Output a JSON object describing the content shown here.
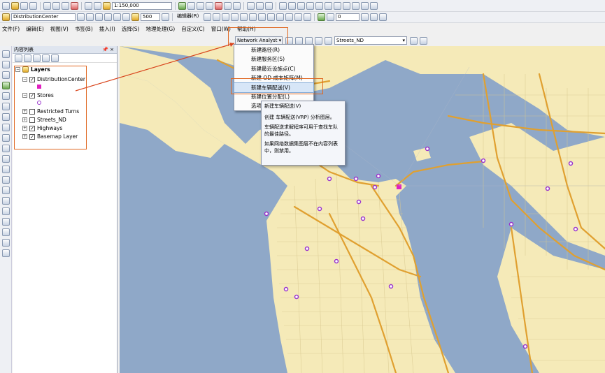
{
  "toolbar1": {
    "scale": "1:150,000"
  },
  "toolbar2": {
    "map_doc": "DistributionCenter",
    "zoom_value": "500",
    "editor_label": "编辑器(R)",
    "angle_value": "0"
  },
  "menu": [
    "文件(F)",
    "编辑(E)",
    "视图(V)",
    "书签(B)",
    "插入(I)",
    "选择(S)",
    "地理处理(G)",
    "自定义(C)",
    "窗口(W)",
    "帮助(H)"
  ],
  "na_toolbar": {
    "button_label": "Network Analyst",
    "network_dataset": "Streets_ND"
  },
  "toc": {
    "title": "内容列表",
    "pin": "📌 ×",
    "root": "Layers",
    "layers": [
      {
        "name": "DistributionCenter",
        "checked": true
      },
      {
        "name": "Stores",
        "checked": true
      },
      {
        "name": "Restricted Turns",
        "checked": false
      },
      {
        "name": "Streets_ND",
        "checked": false
      },
      {
        "name": "Highways",
        "checked": true
      },
      {
        "name": "Basemap Layer",
        "checked": true
      }
    ]
  },
  "dropdown": {
    "items": [
      "新建路径(R)",
      "新建服务区(S)",
      "新建最近设施点(C)",
      "新建 OD 成本矩阵(M)",
      "新建车辆配送(V)",
      "新建位置分配(L)",
      "选项(O)..."
    ],
    "highlighted_index": 4
  },
  "tooltip": {
    "title": "新建车辆配送(V)",
    "line1": "创建 车辆配送(VRP) 分析图层。",
    "line2": "车辆配送求解程序可用于查找车队的最佳路径。",
    "line3": "如果网络数据集图层不在内容列表中，则禁用。"
  },
  "colors": {
    "water": "#8fa8c8",
    "land": "#f5eab8",
    "highway": "#e0a030",
    "store": "#9933cc",
    "center": "#e020c0",
    "callout": "#e0661f"
  }
}
